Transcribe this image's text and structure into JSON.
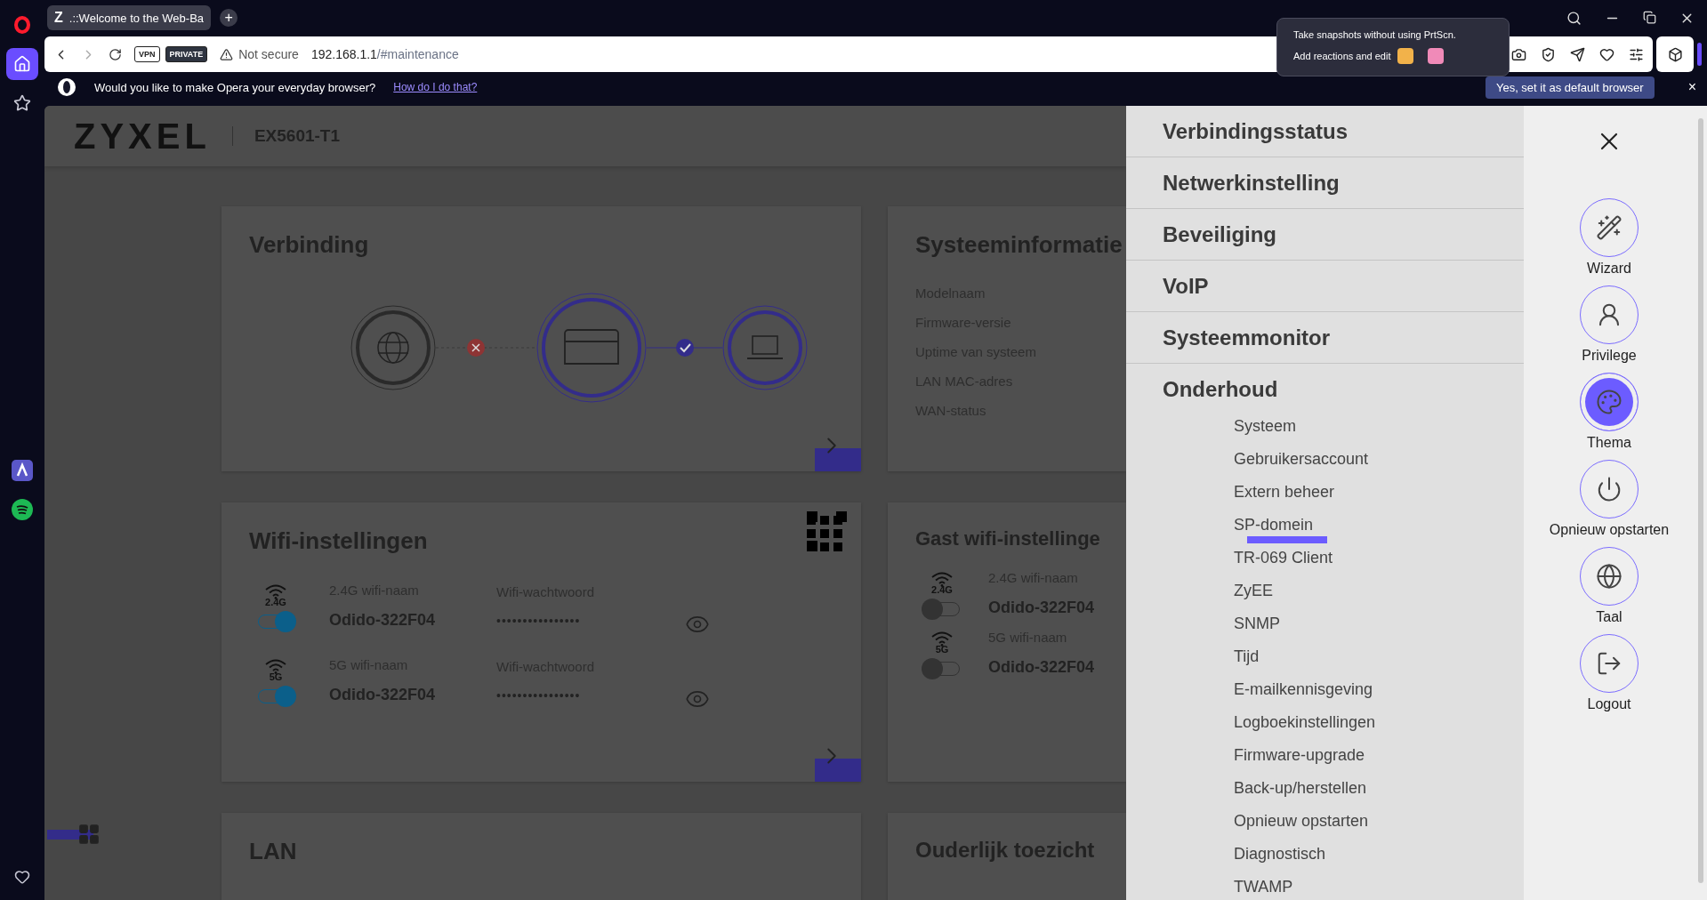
{
  "browser": {
    "sidebar_items": [
      {
        "kind": "opera",
        "selected": false
      },
      {
        "kind": "home",
        "selected": true
      },
      {
        "kind": "star",
        "selected": false
      },
      {
        "kind": "aria",
        "selected": false
      },
      {
        "kind": "spotify",
        "selected": false
      },
      {
        "kind": "heart",
        "selected": false
      }
    ],
    "tab": {
      "favicon": "Z",
      "title": ".::Welcome to the Web-Ba",
      "selected": true
    },
    "new_tab": "+",
    "address": {
      "vpn": "VPN",
      "private": "PRIVATE",
      "security": "Not secure",
      "host": "192.168.1.1",
      "path": "/#maintenance"
    },
    "prompt": {
      "text": "Would you like to make Opera your everyday browser?",
      "link": "How do I do that?",
      "button": "Yes, set it as default browser",
      "close": "×"
    },
    "snapshot_popup": {
      "line_1": "Take snapshots without using PrtScn.",
      "line_2": "Add reactions and edit"
    }
  },
  "router": {
    "brand": "ZYXEL",
    "model": "EX5601-T1"
  },
  "connection": {
    "title": "Verbinding",
    "internet_connected": false,
    "lan_connected": true
  },
  "system_info": {
    "title": "Systeeminformatie",
    "labels": [
      "Modelnaam",
      "Firmware-versie",
      "Uptime van systeem",
      "LAN MAC-adres",
      "WAN-status"
    ]
  },
  "wifi": {
    "title": "Wifi-instellingen",
    "networks": [
      {
        "band": "2.4G",
        "on": true,
        "name_label": "2.4G wifi-naam",
        "name": "Odido-322F04",
        "password_label": "Wifi-wachtwoord",
        "password": "••••••••••••••••"
      },
      {
        "band": "5G",
        "on": true,
        "name_label": "5G wifi-naam",
        "name": "Odido-322F04",
        "password_label": "Wifi-wachtwoord",
        "password": "••••••••••••••••"
      }
    ]
  },
  "guest_wifi": {
    "title": "Gast wifi-instellinge",
    "networks": [
      {
        "band": "2.4G",
        "on": false,
        "name_label": "2.4G wifi-naam",
        "name": "Odido-322F04"
      },
      {
        "band": "5G",
        "on": false,
        "name_label": "5G wifi-naam",
        "name": "Odido-322F04"
      }
    ]
  },
  "lan": {
    "title": "LAN"
  },
  "parental": {
    "title": "Ouderlijk toezicht"
  },
  "menu": {
    "sections": [
      {
        "label": "Verbindingsstatus",
        "expanded": false
      },
      {
        "label": "Netwerkinstelling",
        "expanded": false
      },
      {
        "label": "Beveiliging",
        "expanded": false
      },
      {
        "label": "VoIP",
        "expanded": false
      },
      {
        "label": "Systeemmonitor",
        "expanded": false
      },
      {
        "label": "Onderhoud",
        "expanded": true,
        "children": [
          {
            "label": "Systeem",
            "marked": false
          },
          {
            "label": "Gebruikersaccount",
            "marked": false
          },
          {
            "label": "Extern beheer",
            "marked": false
          },
          {
            "label": "SP-domein",
            "marked": true
          },
          {
            "label": "TR-069 Client",
            "marked": false
          },
          {
            "label": "ZyEE",
            "marked": false
          },
          {
            "label": "SNMP",
            "marked": false
          },
          {
            "label": "Tijd",
            "marked": false
          },
          {
            "label": "E-mailkennisgeving",
            "marked": false
          },
          {
            "label": "Logboekinstellingen",
            "marked": false
          },
          {
            "label": "Firmware-upgrade",
            "marked": false
          },
          {
            "label": "Back-up/herstellen",
            "marked": false
          },
          {
            "label": "Opnieuw opstarten",
            "marked": false
          },
          {
            "label": "Diagnostisch",
            "marked": false
          },
          {
            "label": "TWAMP",
            "marked": false
          }
        ]
      }
    ]
  },
  "actions": [
    {
      "kind": "wizard",
      "label": "Wizard",
      "selected": false
    },
    {
      "kind": "privilege",
      "label": "Privilege",
      "selected": false
    },
    {
      "kind": "theme",
      "label": "Thema",
      "selected": true
    },
    {
      "kind": "restart",
      "label": "Opnieuw opstarten",
      "selected": false
    },
    {
      "kind": "language",
      "label": "Taal",
      "selected": false
    },
    {
      "kind": "logout",
      "label": "Logout",
      "selected": false
    }
  ]
}
